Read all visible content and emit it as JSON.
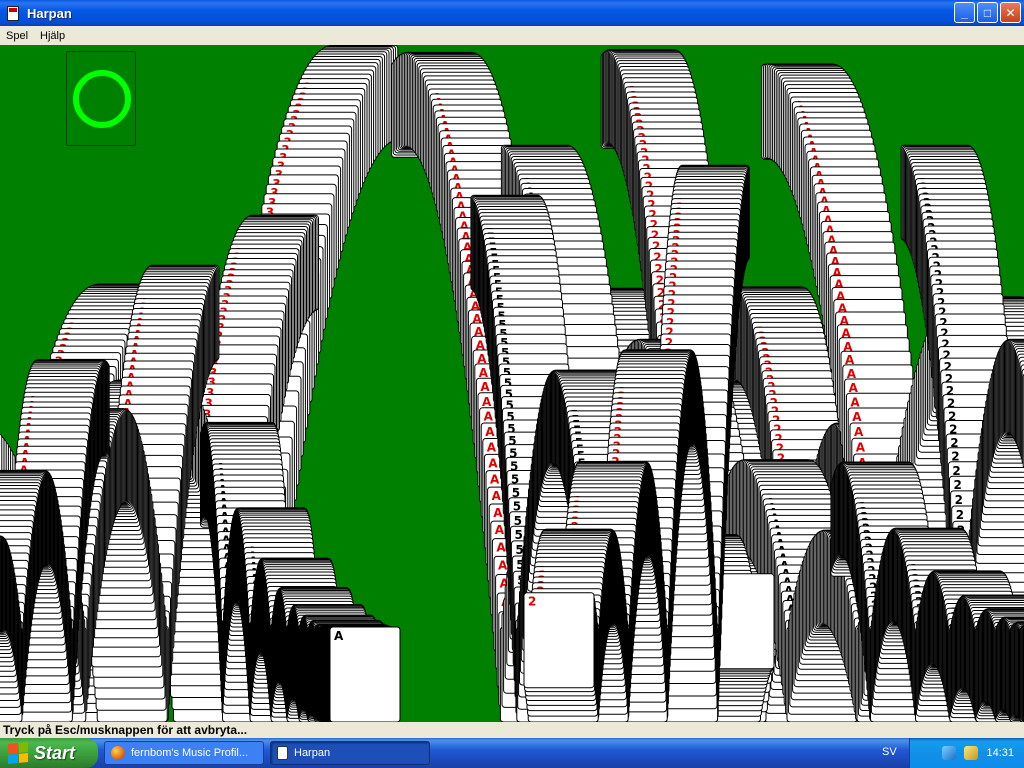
{
  "window": {
    "title": "Harpan",
    "buttons": {
      "minimize": "_",
      "maximize": "□",
      "close": "✕"
    }
  },
  "menu": {
    "items": [
      "Spel",
      "Hjälp"
    ]
  },
  "game": {
    "background_color": "#008000",
    "foundation_color": "#00ff00",
    "card_ranks_visible": [
      "A",
      "2",
      "3",
      "5"
    ],
    "card_suits_visible": [
      "spades",
      "hearts",
      "clubs"
    ]
  },
  "status": {
    "text": "Tryck på Esc/musknappen för att avbryta..."
  },
  "taskbar": {
    "start_label": "Start",
    "tasks": [
      {
        "label": "fernbom's Music Profil..."
      },
      {
        "label": "Harpan"
      }
    ],
    "tray": {
      "language": "SV",
      "clock": "14:31"
    }
  }
}
